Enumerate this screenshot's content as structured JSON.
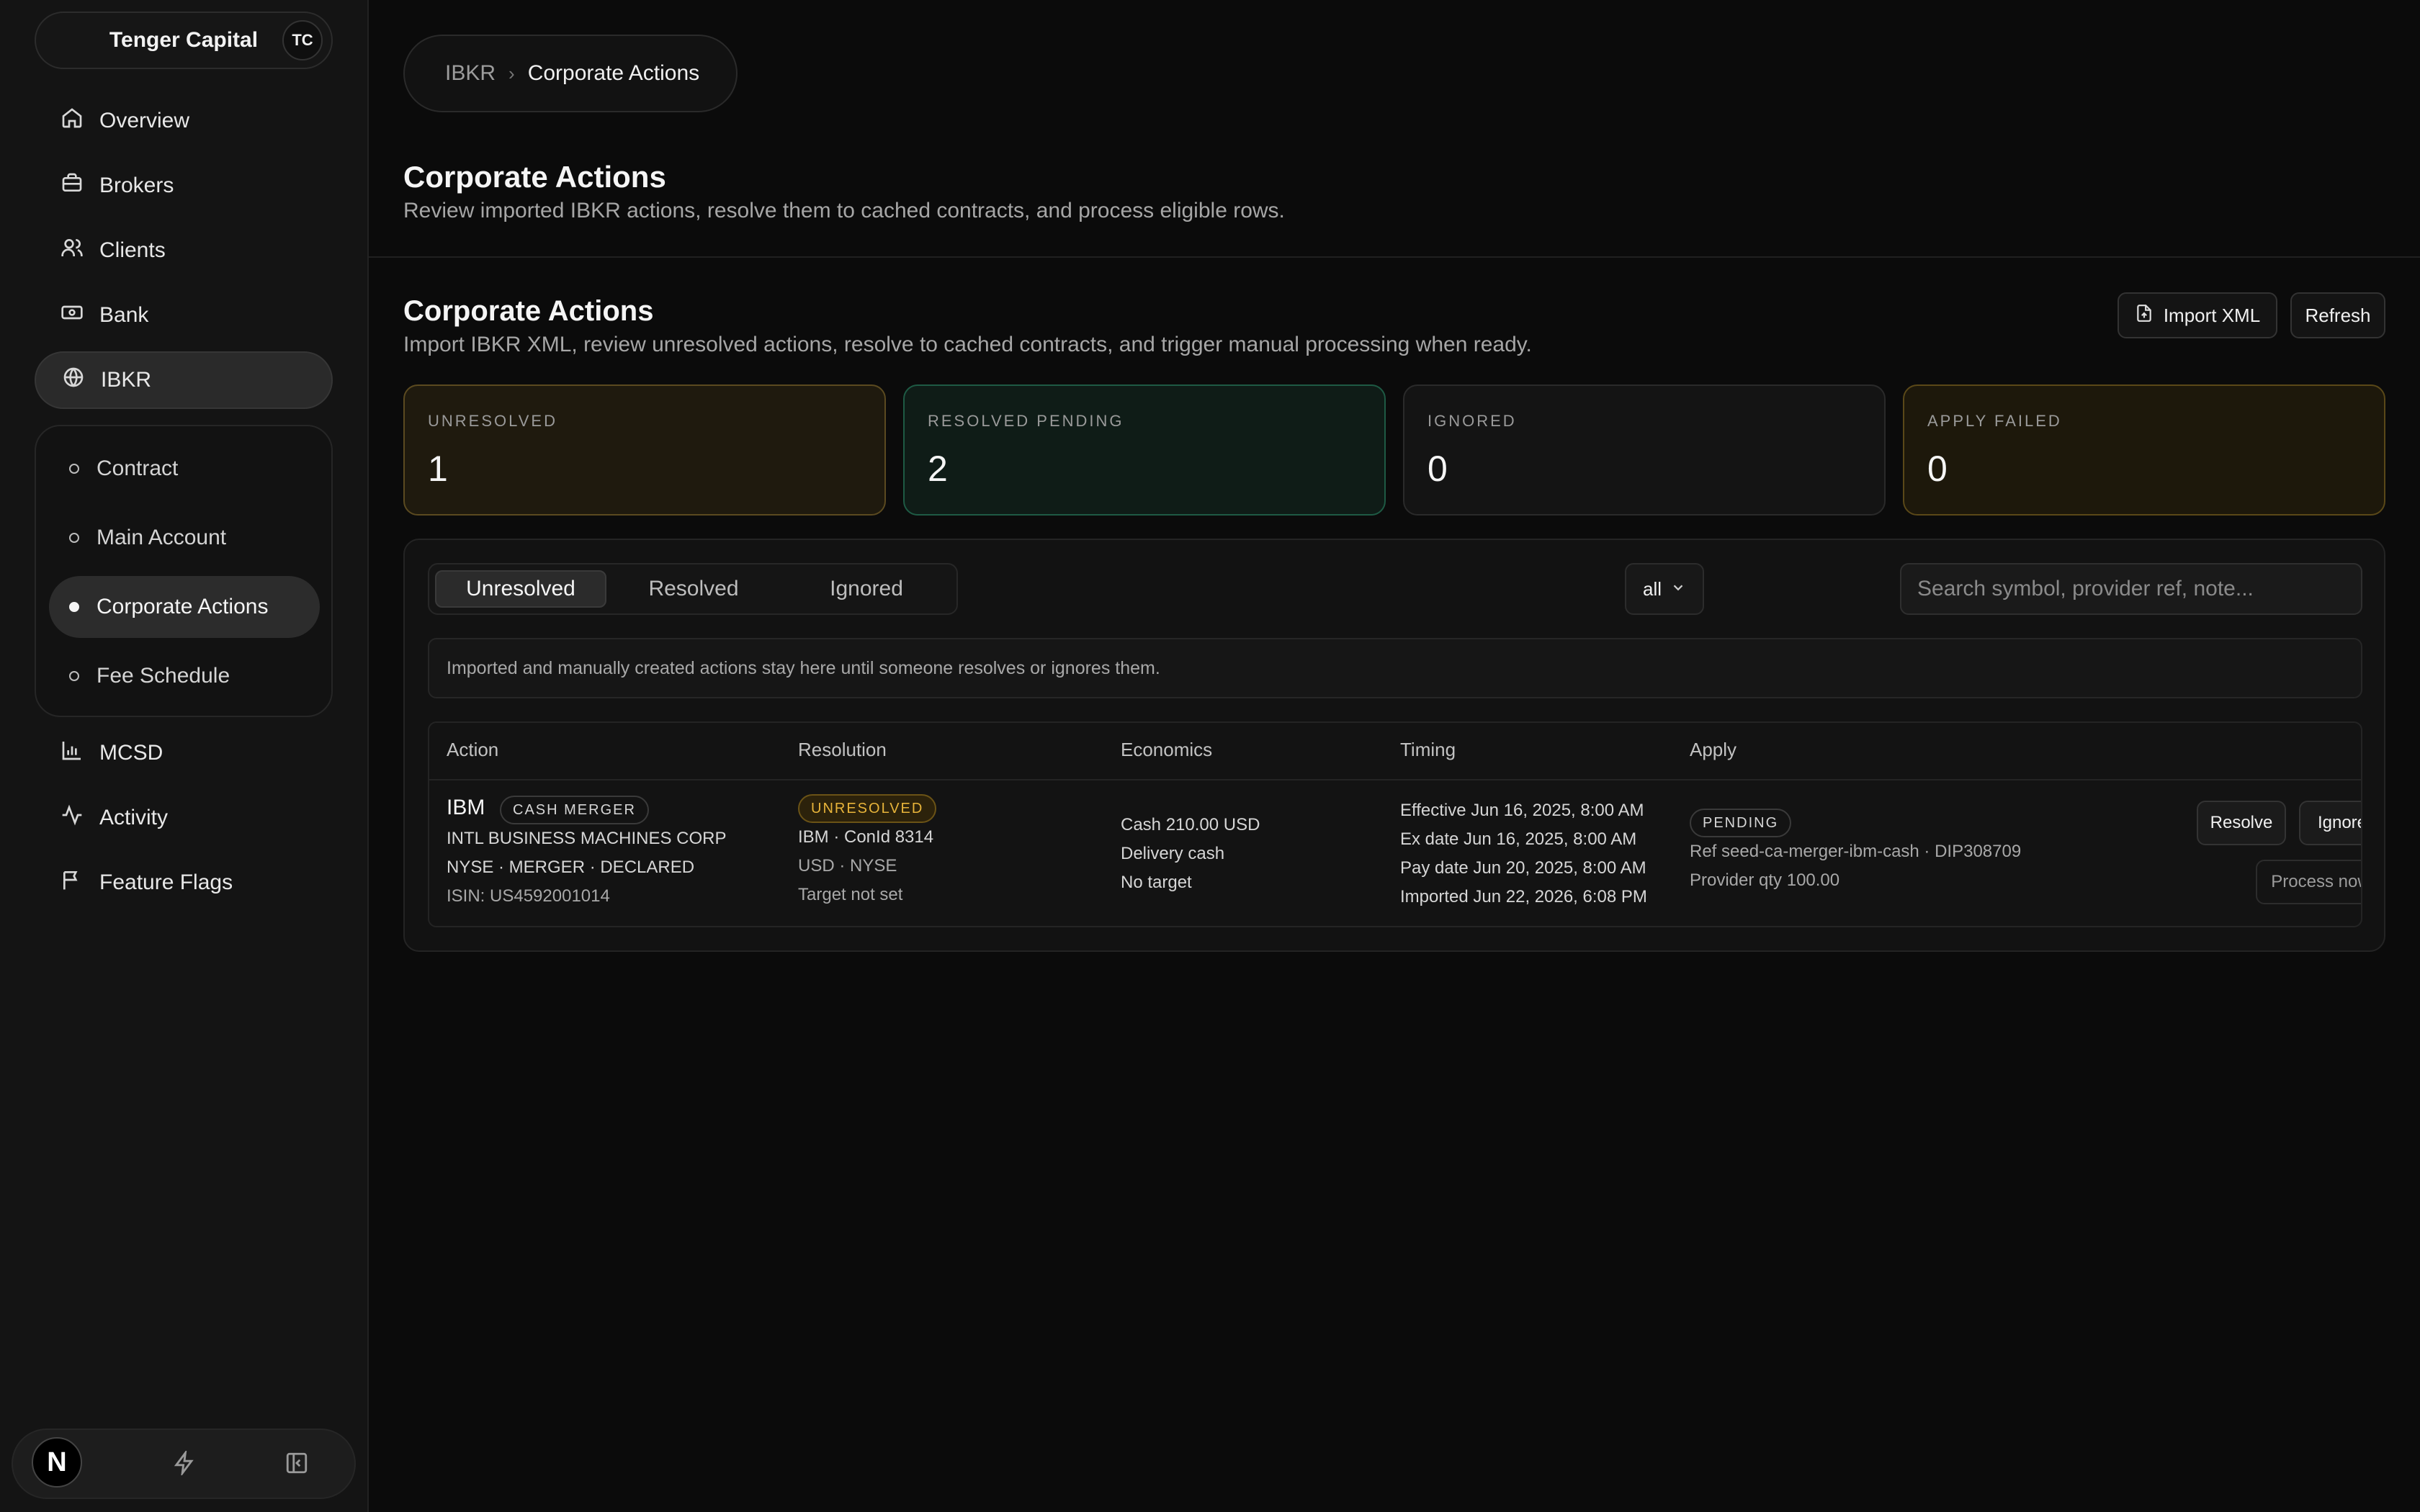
{
  "sidebar": {
    "org_name": "Tenger Capital",
    "org_avatar": "TC",
    "nav": [
      {
        "label": "Overview",
        "icon": "home-icon"
      },
      {
        "label": "Brokers",
        "icon": "briefcase-icon"
      },
      {
        "label": "Clients",
        "icon": "users-icon"
      },
      {
        "label": "Bank",
        "icon": "banknote-icon"
      },
      {
        "label": "IBKR",
        "icon": "globe-icon",
        "active": true
      },
      {
        "label": "MCSD",
        "icon": "bar-chart-icon"
      },
      {
        "label": "Activity",
        "icon": "activity-icon"
      },
      {
        "label": "Feature Flags",
        "icon": "flag-icon"
      }
    ],
    "sub_nav": [
      {
        "label": "Contract"
      },
      {
        "label": "Main Account"
      },
      {
        "label": "Corporate Actions",
        "active": true
      },
      {
        "label": "Fee Schedule"
      }
    ],
    "footer": {
      "next_logo": "N"
    }
  },
  "breadcrumb": {
    "parent": "IBKR",
    "current": "Corporate Actions"
  },
  "header": {
    "title": "Corporate Actions",
    "subtitle": "Review imported IBKR actions, resolve them to cached contracts, and process eligible rows."
  },
  "section": {
    "title": "Corporate Actions",
    "subtitle": "Import IBKR XML, review unresolved actions, resolve to cached contracts, and trigger manual processing when ready.",
    "import_label": "Import XML",
    "refresh_label": "Refresh"
  },
  "stats": [
    {
      "label": "UNRESOLVED",
      "value": "1",
      "color": "#5b4a20"
    },
    {
      "label": "RESOLVED PENDING",
      "value": "2",
      "color": "#1e5a44"
    },
    {
      "label": "IGNORED",
      "value": "0",
      "color": "#2a2a2a"
    },
    {
      "label": "APPLY FAILED",
      "value": "0",
      "color": "#5a4818"
    }
  ],
  "filters": {
    "tabs": [
      "Unresolved",
      "Resolved",
      "Ignored"
    ],
    "active_tab": "Unresolved",
    "select_value": "all",
    "search_placeholder": "Search symbol, provider ref, note..."
  },
  "notice": "Imported and manually created actions stay here until someone resolves or ignores them.",
  "table": {
    "columns": [
      "Action",
      "Resolution",
      "Economics",
      "Timing",
      "Apply"
    ],
    "rows": [
      {
        "action": {
          "symbol": "IBM",
          "type_badge": "CASH MERGER",
          "name": "INTL BUSINESS MACHINES CORP",
          "meta": "NYSE · MERGER · DECLARED",
          "isin": "ISIN: US4592001014"
        },
        "resolution": {
          "status_badge": "UNRESOLVED",
          "contract": "IBM · ConId 8314",
          "market": "USD · NYSE",
          "target": "Target not set"
        },
        "economics": {
          "cash": "Cash 210.00 USD",
          "delivery": "Delivery cash",
          "target": "No target"
        },
        "timing": {
          "effective": "Effective Jun 16, 2025, 8:00 AM",
          "ex_date": "Ex date Jun 16, 2025, 8:00 AM",
          "pay_date": "Pay date Jun 20, 2025, 8:00 AM",
          "imported": "Imported Jun 22, 2026, 6:08 PM"
        },
        "apply": {
          "status_badge": "PENDING",
          "ref": "Ref seed-ca-merger-ibm-cash · DIP308709",
          "qty": "Provider qty 100.00"
        },
        "buttons": {
          "resolve": "Resolve",
          "ignore": "Ignore",
          "process": "Process now"
        }
      }
    ]
  },
  "colors": {
    "accent_warn": "#e8b43a",
    "accent_ok": "#1e5a44",
    "background": "#0b0b0b"
  }
}
